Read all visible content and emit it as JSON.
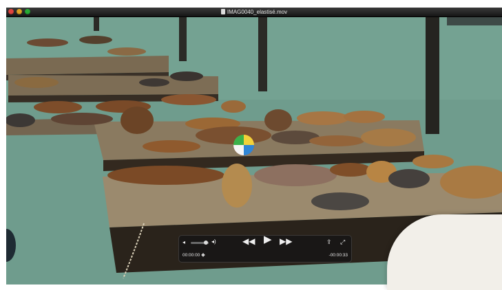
{
  "window": {
    "title": "IMAG0040_elastisé.mov"
  },
  "player": {
    "current_time": "00:00:00",
    "remaining_time": "-00:00:33",
    "play_icon": "play-icon",
    "rewind_icon": "rewind-icon",
    "fast_forward_icon": "fast-forward-icon",
    "volume_low_icon": "volume-low-icon",
    "volume_high_icon": "volume-high-icon",
    "share_icon": "share-icon",
    "fullscreen_icon": "fullscreen-icon",
    "volume_level": 0.75,
    "playback_position": 0.0
  },
  "colors": {
    "water": "#6f9c8d",
    "dock": "#7a6a52",
    "sea_lion": "#8b5a30",
    "hud_bg": "#141414"
  }
}
